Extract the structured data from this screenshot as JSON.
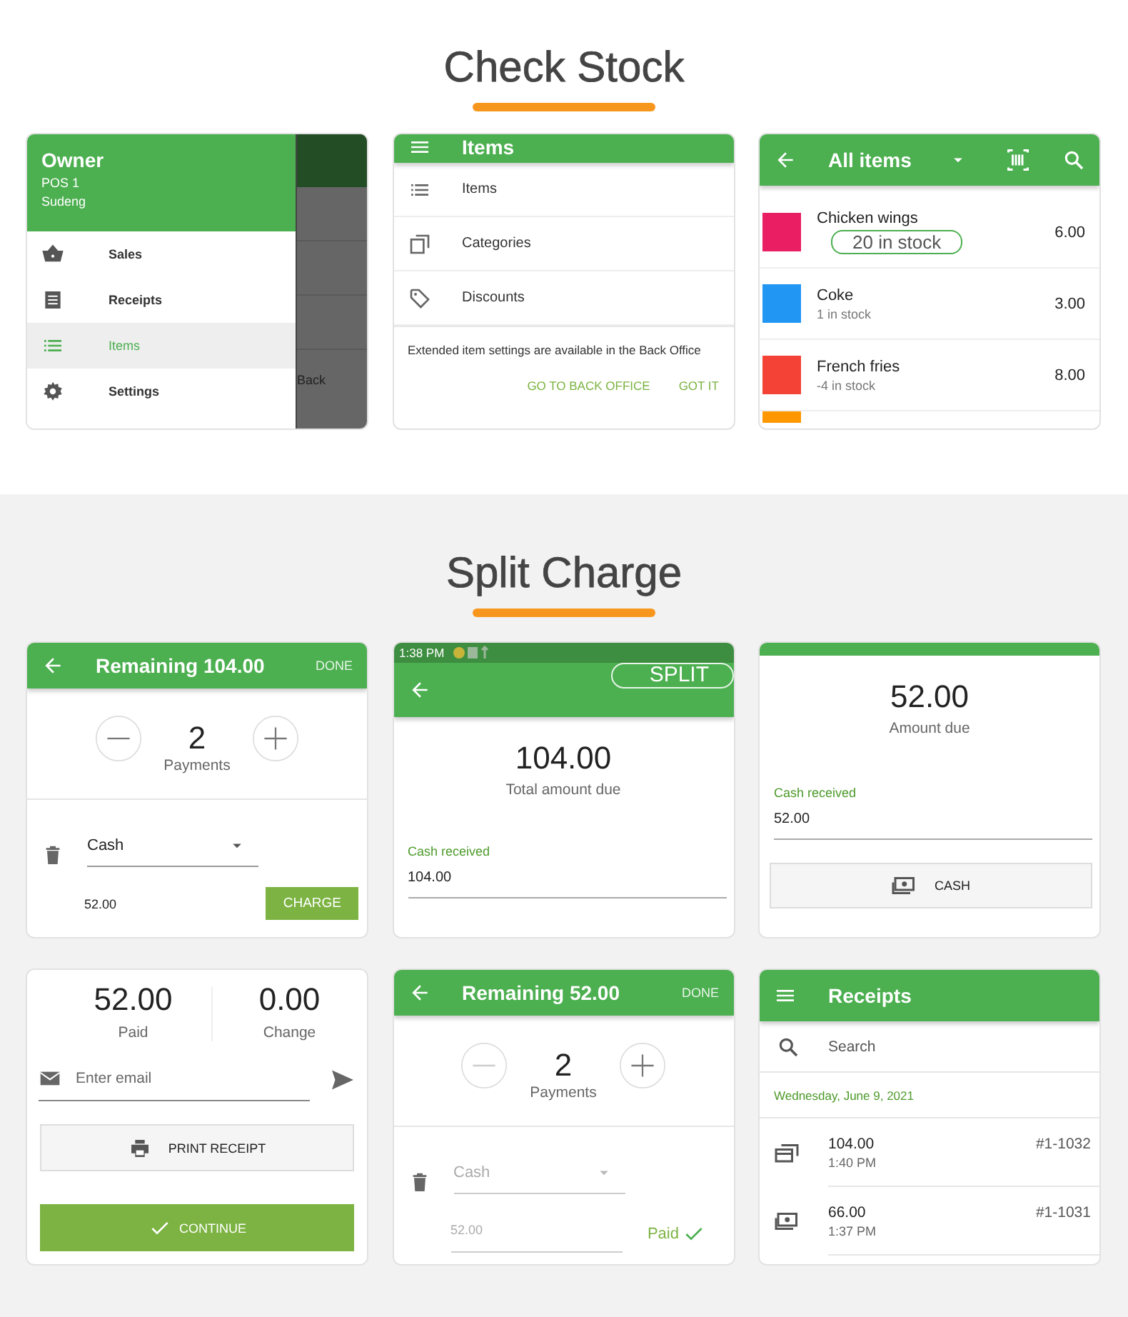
{
  "sections": [
    {
      "title": "Check Stock",
      "screens": [
        {
          "kind": "drawer",
          "user": "Owner",
          "lines": [
            "POS 1",
            "Sudeng"
          ],
          "backdrop_text": "Back",
          "items": [
            {
              "label": "Sales",
              "selected": false
            },
            {
              "label": "Receipts",
              "selected": false
            },
            {
              "label": "Items",
              "selected": true
            },
            {
              "label": "Settings",
              "selected": false
            }
          ]
        },
        {
          "kind": "items_menu",
          "title": "Items",
          "items": [
            "Items",
            "Categories",
            "Discounts"
          ],
          "note": "Extended item settings are available in the Back Office",
          "actions": [
            "GO TO BACK OFFICE",
            "GOT IT"
          ]
        },
        {
          "kind": "item_list",
          "title": "All items",
          "callout": "20 in stock",
          "items": [
            {
              "name": "Chicken wings",
              "price": "6.00",
              "color": "#e91e63"
            },
            {
              "name": "Coke",
              "stock": "1 in stock",
              "price": "3.00",
              "color": "#2196f3"
            },
            {
              "name": "French fries",
              "stock": "-4 in stock",
              "price": "8.00",
              "color": "#f44336"
            },
            {
              "color": "#ff9800"
            }
          ]
        }
      ]
    },
    {
      "title": "Split Charge",
      "screens": [
        {
          "kind": "split",
          "title": "Remaining 104.00",
          "action": "DONE",
          "count": "2",
          "count_label": "Payments",
          "payment": {
            "method": "Cash",
            "amount": "52.00",
            "paid": false,
            "action": "CHARGE"
          }
        },
        {
          "kind": "cash",
          "status_time": "1:38 PM",
          "callout": "SPLIT",
          "amount": "104.00",
          "amount_label": "Total amount due",
          "field_label": "Cash received",
          "field_value": "104.00"
        },
        {
          "kind": "cash",
          "amount": "52.00",
          "amount_label": "Amount due",
          "field_label": "Cash received",
          "field_value": "52.00",
          "button": "CASH"
        },
        {
          "kind": "done",
          "paid": "52.00",
          "paid_label": "Paid",
          "change": "0.00",
          "change_label": "Change",
          "email_placeholder": "Enter email",
          "print": "PRINT RECEIPT",
          "continue": "CONTINUE"
        },
        {
          "kind": "split",
          "title": "Remaining 52.00",
          "action": "DONE",
          "count": "2",
          "count_label": "Payments",
          "payment": {
            "method": "Cash",
            "amount": "52.00",
            "paid": true,
            "action": "Paid"
          }
        },
        {
          "kind": "receipts",
          "title": "Receipts",
          "search_placeholder": "Search",
          "date": "Wednesday, June 9, 2021",
          "rows": [
            {
              "amount": "104.00",
              "time": "1:40 PM",
              "number": "#1-1032"
            },
            {
              "amount": "66.00",
              "time": "1:37 PM",
              "number": "#1-1031"
            }
          ]
        }
      ]
    }
  ]
}
